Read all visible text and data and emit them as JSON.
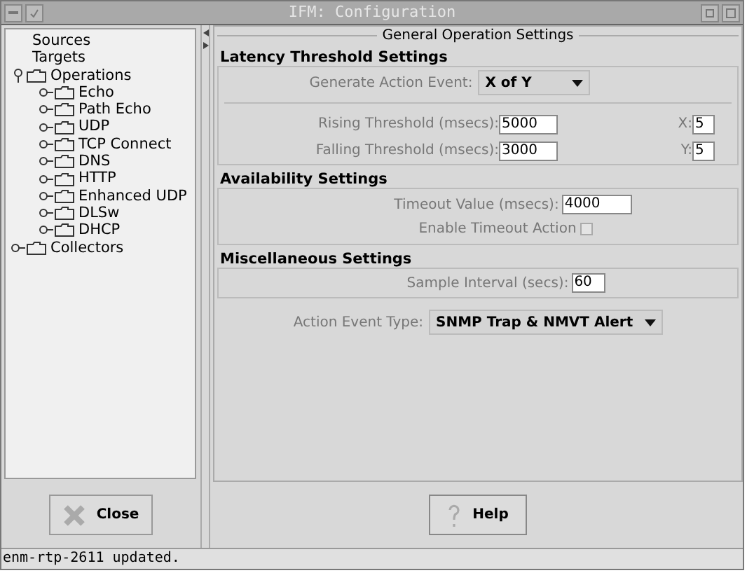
{
  "window": {
    "title": "IFM: Configuration"
  },
  "tree": [
    {
      "label": "Sources",
      "kind": "leaf"
    },
    {
      "label": "Targets",
      "kind": "leaf"
    },
    {
      "label": "Operations",
      "kind": "folder",
      "expanded": true,
      "children": [
        {
          "label": "Echo",
          "kind": "folder",
          "expanded": false
        },
        {
          "label": "Path Echo",
          "kind": "folder",
          "expanded": false
        },
        {
          "label": "UDP",
          "kind": "folder",
          "expanded": false
        },
        {
          "label": "TCP Connect",
          "kind": "folder",
          "expanded": false
        },
        {
          "label": "DNS",
          "kind": "folder",
          "expanded": false
        },
        {
          "label": "HTTP",
          "kind": "folder",
          "expanded": false
        },
        {
          "label": "Enhanced UDP",
          "kind": "folder",
          "expanded": false
        },
        {
          "label": "DLSw",
          "kind": "folder",
          "expanded": false
        },
        {
          "label": "DHCP",
          "kind": "folder",
          "expanded": false
        }
      ]
    },
    {
      "label": "Collectors",
      "kind": "folder",
      "expanded": false
    }
  ],
  "close_button": "Close",
  "panel_title": "General Operation Settings",
  "latency": {
    "title": "Latency Threshold Settings",
    "generate_label": "Generate Action Event:",
    "generate_value": "X of Y",
    "rising_label": "Rising Threshold (msecs):",
    "rising_value": "5000",
    "x_label": "X:",
    "x_value": "5",
    "falling_label": "Falling Threshold (msecs):",
    "falling_value": "3000",
    "y_label": "Y:",
    "y_value": "5"
  },
  "availability": {
    "title": "Availability Settings",
    "timeout_label": "Timeout Value (msecs):",
    "timeout_value": "4000",
    "enable_label": "Enable Timeout Action",
    "enable_checked": false
  },
  "misc": {
    "title": "Miscellaneous Settings",
    "sample_label": "Sample Interval (secs):",
    "sample_value": "60"
  },
  "action_event": {
    "label": "Action Event Type:",
    "value": "SNMP Trap & NMVT Alert"
  },
  "help_button": "Help",
  "status_bar": "enm-rtp-2611 updated."
}
